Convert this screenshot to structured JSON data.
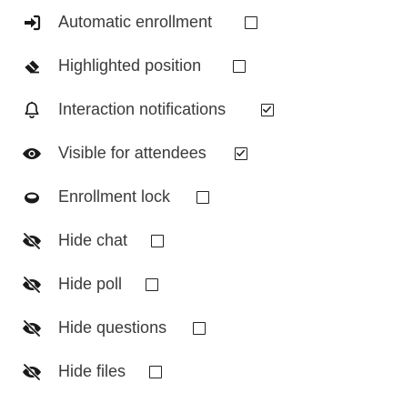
{
  "settings": [
    {
      "label": "Automatic enrollment",
      "icon": "sign-in-arrow-icon",
      "checked": false
    },
    {
      "label": "Highlighted position",
      "icon": "eraser-icon",
      "checked": false
    },
    {
      "label": "Interaction notifications",
      "icon": "bell-icon",
      "checked": true
    },
    {
      "label": "Visible for attendees",
      "icon": "eye-icon",
      "checked": true
    },
    {
      "label": "Enrollment lock",
      "icon": "ring-icon",
      "checked": false
    },
    {
      "label": "Hide chat",
      "icon": "eye-slash-icon",
      "checked": false
    },
    {
      "label": "Hide poll",
      "icon": "eye-slash-icon",
      "checked": false
    },
    {
      "label": "Hide questions",
      "icon": "eye-slash-icon",
      "checked": false
    },
    {
      "label": "Hide files",
      "icon": "eye-slash-icon",
      "checked": false
    }
  ]
}
